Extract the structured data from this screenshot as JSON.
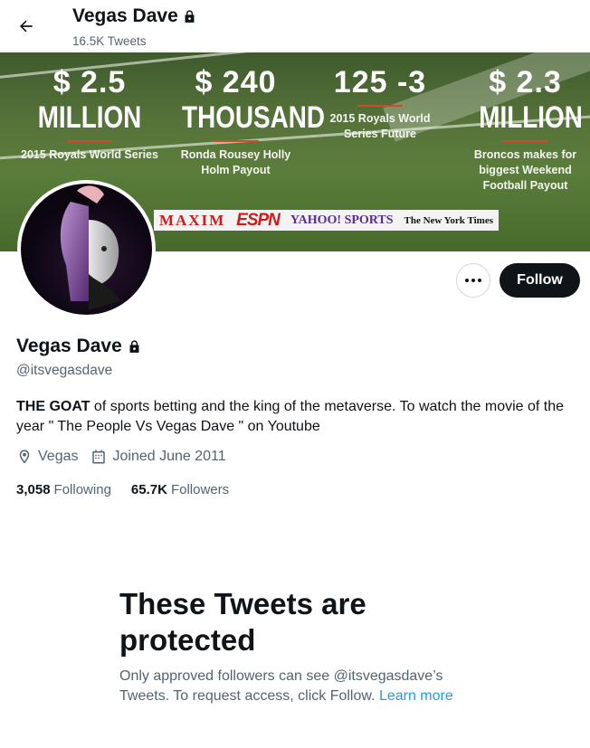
{
  "header": {
    "name": "Vegas Dave",
    "tweet_count": "16.5K Tweets"
  },
  "banner": {
    "columns": [
      {
        "number": "$ 2.5",
        "word": "MILLION",
        "caption": "2015 Royals World Series"
      },
      {
        "number": "$ 240",
        "word": "THOUSAND",
        "caption": "Ronda Rousey Holly Holm Payout"
      },
      {
        "number": "125 -3",
        "word": "",
        "caption": "2015 Royals World Series Future"
      },
      {
        "number": "$ 2.3",
        "word": "MILLION",
        "caption": "Broncos makes for biggest Weekend Football Payout"
      }
    ],
    "logos": [
      "MAXIM",
      "ESPN",
      "YAHOO! SPORTS",
      "The New York Times"
    ]
  },
  "actions": {
    "follow_label": "Follow"
  },
  "profile": {
    "name": "Vegas Dave",
    "handle": "@itsvegasdave",
    "bio_bold": "THE GOAT",
    "bio_rest": " of sports betting and the king of the metaverse. To watch the movie of the year \" The People Vs Vegas Dave \" on Youtube",
    "location": "Vegas",
    "joined": "Joined June 2011",
    "following_count": "3,058",
    "following_label": "Following",
    "followers_count": "65.7K",
    "followers_label": "Followers"
  },
  "protected": {
    "title": "These Tweets are protected",
    "text": "Only approved followers can see @itsvegasdave’s Tweets. To request access, click Follow. ",
    "link": "Learn more"
  }
}
